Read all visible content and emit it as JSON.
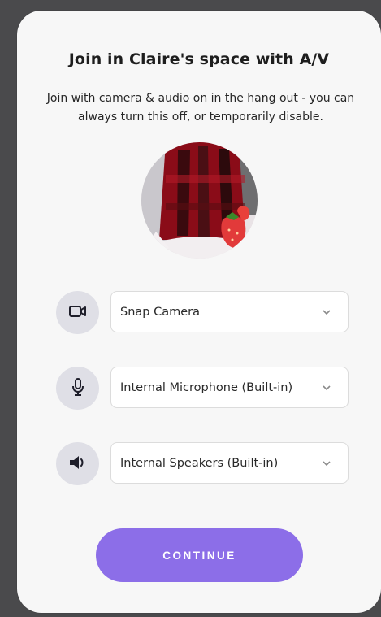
{
  "dialog": {
    "title": "Join in Claire's space with A/V",
    "subtitle": "Join with camera & audio on in the hang out - you can always turn this off, or temporarily disable."
  },
  "devices": {
    "camera": {
      "icon": "video-camera-icon",
      "selected": "Snap Camera"
    },
    "microphone": {
      "icon": "microphone-icon",
      "selected": "Internal Microphone (Built-in)"
    },
    "speakers": {
      "icon": "speaker-icon",
      "selected": "Internal Speakers (Built-in)"
    }
  },
  "actions": {
    "continue_label": "CONTINUE"
  },
  "colors": {
    "accent": "#8c6ee8",
    "icon_bg": "#dfdfe6",
    "card_bg": "#f7f7f7",
    "backdrop": "#4a4a4c"
  }
}
